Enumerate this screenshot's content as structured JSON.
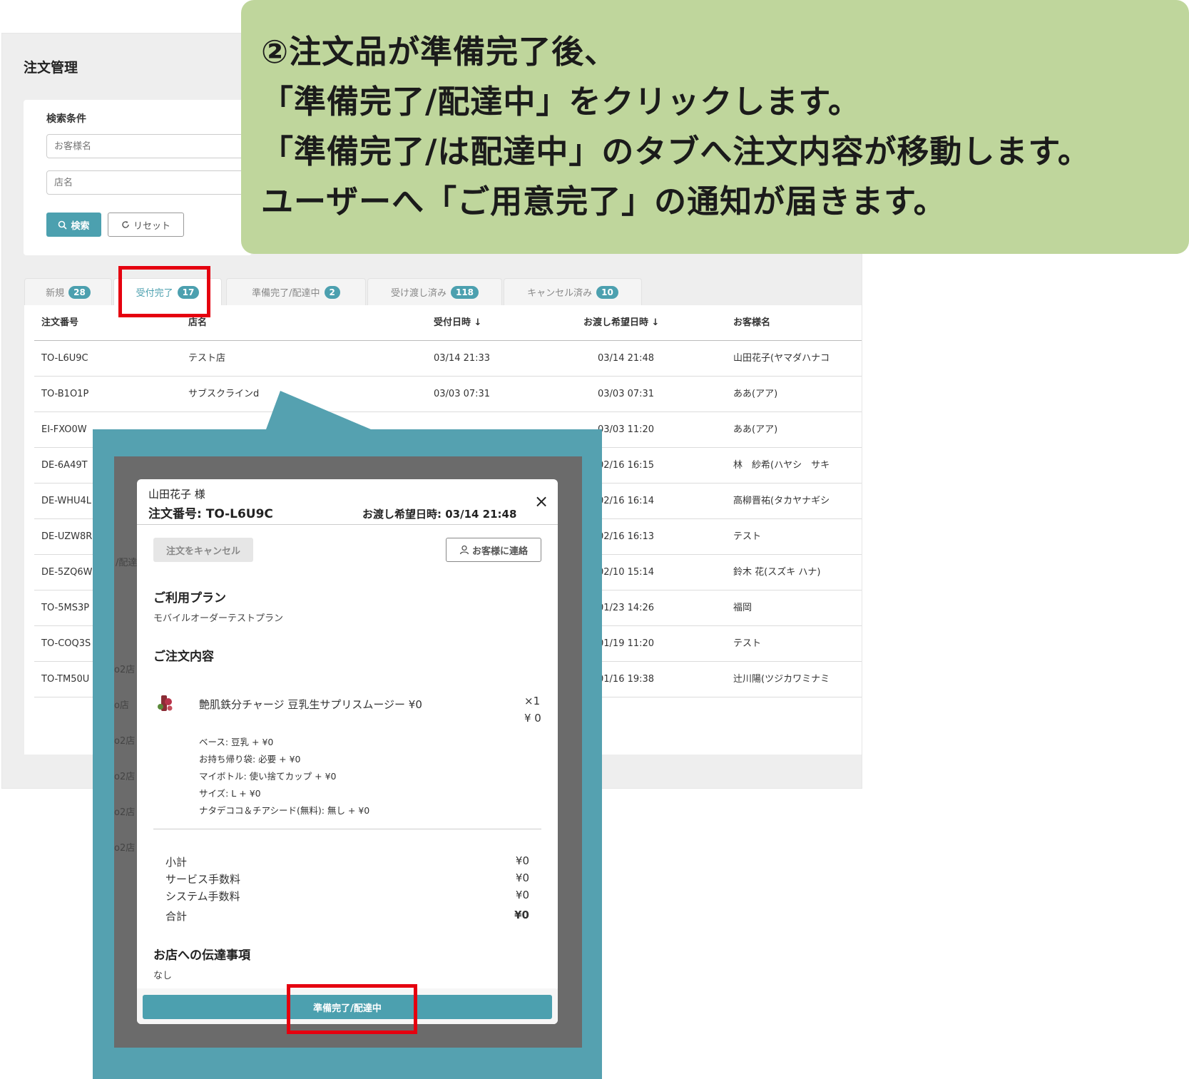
{
  "callout": {
    "line1": "②注文品が準備完了後、",
    "line2": "「準備完了/配達中」をクリックします。",
    "line3": "「準備完了/は配達中」のタブへ注文内容が移動します。",
    "line4": "ユーザーへ「ご用意完了」の通知が届きます。"
  },
  "app": {
    "title": "注文管理",
    "search": {
      "heading": "検索条件",
      "customer_placeholder": "お客様名",
      "store_placeholder": "店名",
      "search_label": "検索",
      "reset_label": "リセット"
    },
    "tabs": [
      {
        "label": "新規",
        "count": "28"
      },
      {
        "label": "受付完了",
        "count": "17"
      },
      {
        "label": "準備完了/配達中",
        "count": "2"
      },
      {
        "label": "受け渡し済み",
        "count": "118"
      },
      {
        "label": "キャンセル済み",
        "count": "10"
      }
    ],
    "table": {
      "headers": [
        "注文番号",
        "店名",
        "受付日時 ↓",
        "お渡し希望日時 ↓",
        "お客様名"
      ],
      "rows": [
        [
          "TO-L6U9C",
          "テスト店",
          "03/14 21:33",
          "03/14 21:48",
          "山田花子(ヤマダハナコ"
        ],
        [
          "TO-B1O1P",
          "サブスクラインd",
          "03/03 07:31",
          "03/03 07:31",
          "ああ(アア)"
        ],
        [
          "EI-FXO0W",
          "",
          "",
          "03/03 11:20",
          "ああ(アア)"
        ],
        [
          "DE-6A49T",
          "",
          "",
          "02/16 16:15",
          "林　紗希(ハヤシ　サキ"
        ],
        [
          "DE-WHU4L",
          "",
          "",
          "02/16 16:14",
          "高柳晋祐(タカヤナギシ"
        ],
        [
          "DE-UZW8R",
          "",
          "",
          "02/16 16:13",
          "テスト"
        ],
        [
          "DE-5ZQ6W",
          "",
          "",
          "02/10 15:14",
          "鈴木 花(スズキ ハナ)"
        ],
        [
          "TO-5MS3P",
          "",
          "",
          "01/23 14:26",
          "福岡"
        ],
        [
          "TO-COQ3S",
          "",
          "",
          "01/19 11:20",
          "テスト"
        ],
        [
          "TO-TM50U",
          "",
          "",
          "01/16 19:38",
          "辻川陽(ツジカワミナミ"
        ]
      ]
    },
    "ghost_texts": [
      "/配達",
      "o2店",
      "o店",
      "o2店",
      "o2店",
      "o2店",
      "o2店"
    ]
  },
  "modal": {
    "customer": "山田花子 様",
    "order_no": "注文番号: TO-L6U9C",
    "pickup": "お渡し希望日時: 03/14 21:48",
    "close": "×",
    "cancel_label": "注文をキャンセル",
    "contact_label": "お客様に連絡",
    "plan_heading": "ご利用プラン",
    "plan": "モバイルオーダーテストプラン",
    "order_heading": "ご注文内容",
    "item_name": "艶肌鉄分チャージ 豆乳生サプリスムージー ¥0",
    "item_qty": "×1",
    "item_price": "¥ 0",
    "options": [
      "ベース: 豆乳 + ¥0",
      "お持ち帰り袋: 必要 + ¥0",
      "マイボトル: 使い捨てカップ + ¥0",
      "サイズ: L + ¥0",
      "ナタデココ＆チアシード(無料): 無し + ¥0"
    ],
    "summary": [
      {
        "label": "小計",
        "value": "¥0"
      },
      {
        "label": "サービス手数料",
        "value": "¥0"
      },
      {
        "label": "システム手数料",
        "value": "¥0"
      },
      {
        "label": "合計",
        "value": "¥0"
      }
    ],
    "note_heading": "お店への伝達事項",
    "note": "なし",
    "ready_label": "準備完了/配達中"
  },
  "colors": {
    "accent": "#4ca0af",
    "callout_bg": "#bfd69c",
    "highlight": "#e5000f"
  }
}
